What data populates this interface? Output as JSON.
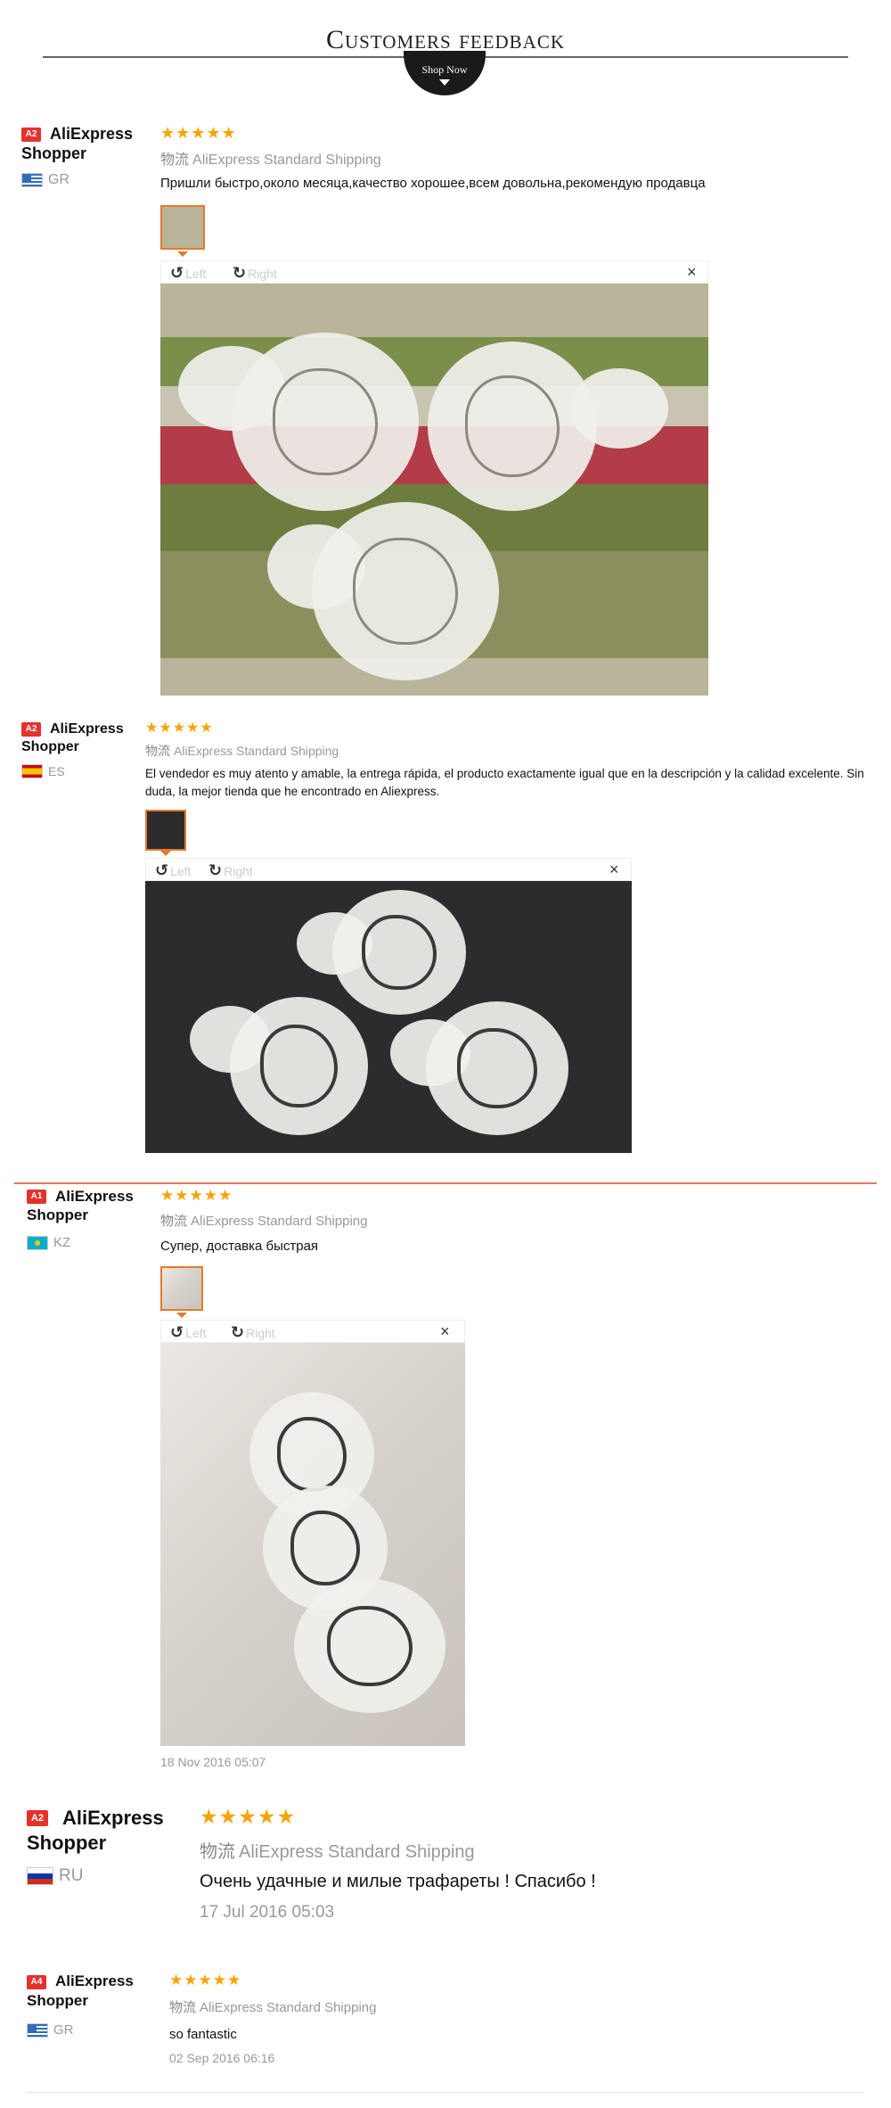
{
  "header": {
    "title": "Customers feedback",
    "shop_now": "Shop Now"
  },
  "colors": {
    "star": "#f7a400",
    "badge": "#e5312d",
    "divider": "#e07a5f"
  },
  "viewer": {
    "left_label": "Left",
    "right_label": "Right",
    "close": "×"
  },
  "reviews": [
    {
      "badge": "A2",
      "name_line1": "AliExpress",
      "name_line2": "Shopper",
      "country": "GR",
      "stars": "★★★★★",
      "shipping_prefix": "物流",
      "shipping": "AliExpress Standard Shipping",
      "text": "Пришли быстро,около месяца,качество хорошее,всем довольна,рекомендую продавца",
      "date": ""
    },
    {
      "badge": "A2",
      "name_line1": "AliExpress",
      "name_line2": "Shopper",
      "country": "ES",
      "stars": "★★★★★",
      "shipping_prefix": "物流",
      "shipping": "AliExpress Standard Shipping",
      "text": "El vendedor es muy atento y amable, la entrega rápida, el producto exactamente igual que en la descripción y la calidad excelente. Sin duda, la mejor tienda que he encontrado en Aliexpress.",
      "date": ""
    },
    {
      "badge": "A1",
      "name_line1": "AliExpress",
      "name_line2": "Shopper",
      "country": "KZ",
      "stars": "★★★★★",
      "shipping_prefix": "物流",
      "shipping": "AliExpress Standard Shipping",
      "text": "Супер, доставка быстрая",
      "date": "18 Nov 2016 05:07"
    },
    {
      "badge": "A2",
      "name_line1": "AliExpress",
      "name_line2": "Shopper",
      "country": "RU",
      "stars": "★★★★★",
      "shipping_prefix": "物流",
      "shipping": "AliExpress Standard Shipping",
      "text": "Очень удачные и милые трафареты ! Спасибо !",
      "date": "17 Jul 2016 05:03"
    },
    {
      "badge": "A4",
      "name_line1": "AliExpress",
      "name_line2": "Shopper",
      "country": "GR",
      "stars": "★★★★★",
      "shipping_prefix": "物流",
      "shipping": "AliExpress Standard Shipping",
      "text": "so fantastic",
      "date": "02 Sep 2016 06:16"
    }
  ]
}
